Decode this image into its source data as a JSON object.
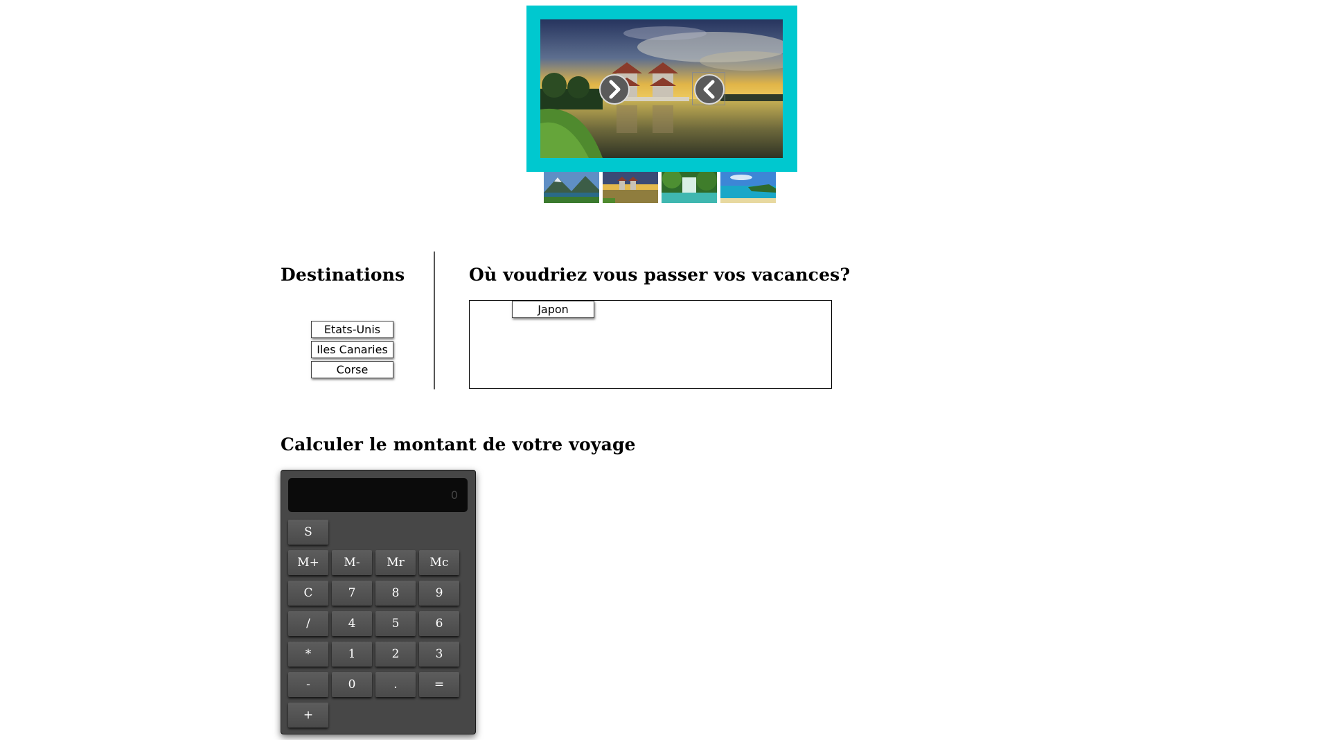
{
  "slider": {
    "frame_color": "#00c8cf",
    "next_icon": "chevron-right-icon",
    "prev_icon": "chevron-left-icon",
    "thumbnails": [
      "mountain-lake",
      "twin-pagodas",
      "tropical-waterfall",
      "tropical-beach"
    ]
  },
  "destinations": {
    "title": "Destinations",
    "items": [
      "Etats-Unis",
      "Iles Canaries",
      "Corse"
    ]
  },
  "vacation": {
    "question": "Où voudriez vous passer vos vacances?",
    "dropped_items": [
      "Japon"
    ]
  },
  "calculator": {
    "title": "Calculer le montant de votre voyage",
    "display": "0",
    "keys": [
      "S",
      "M+",
      "M-",
      "Mr",
      "Mc",
      "C",
      "7",
      "8",
      "9",
      "/",
      "4",
      "5",
      "6",
      "*",
      "1",
      "2",
      "3",
      "-",
      "0",
      ".",
      "=",
      "+"
    ]
  }
}
